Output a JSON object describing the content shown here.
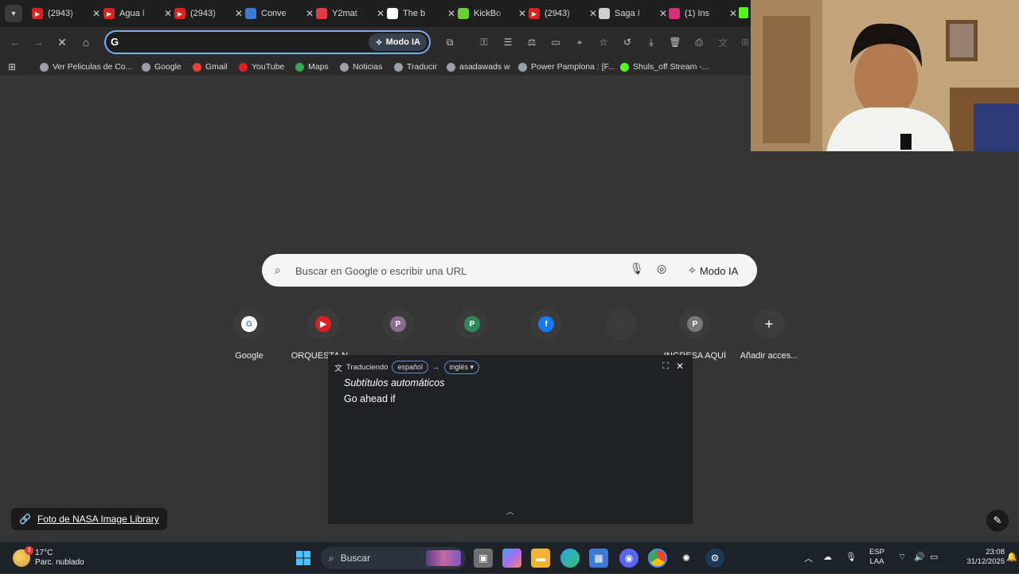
{
  "tabs": [
    {
      "title": "(2943)",
      "icon": "youtube-icon",
      "color": "#e02020"
    },
    {
      "title": "Agua I",
      "icon": "youtube-icon",
      "color": "#e02020"
    },
    {
      "title": "(2943)",
      "icon": "youtube-icon",
      "color": "#e02020"
    },
    {
      "title": "Conve",
      "icon": "convert-icon",
      "color": "#3a7bd5"
    },
    {
      "title": "Y2mat",
      "icon": "download-icon",
      "color": "#e0394a"
    },
    {
      "title": "The b",
      "icon": "diamond-icon",
      "color": "#ffffff"
    },
    {
      "title": "KickBo",
      "icon": "kickbox-icon",
      "color": "#6ad12a"
    },
    {
      "title": "(2943)",
      "icon": "youtube-icon",
      "color": "#e02020"
    },
    {
      "title": "Saga I",
      "icon": "openai-icon",
      "color": "#cfcfcf"
    },
    {
      "title": "(1) Ins",
      "icon": "instagram-icon",
      "color": "#d6307a"
    }
  ],
  "omnibox": {
    "value": "",
    "ai_label": "Modo IA"
  },
  "bookmarks": [
    {
      "label": "Ver Peliculas de Co...",
      "icon": "globe-icon",
      "color": "#9aa0a6"
    },
    {
      "label": "Google",
      "icon": "globe-icon",
      "color": "#9aa0a6"
    },
    {
      "label": "Gmail",
      "icon": "gmail-icon",
      "color": "#ea4335"
    },
    {
      "label": "YouTube",
      "icon": "youtube-icon",
      "color": "#e02020"
    },
    {
      "label": "Maps",
      "icon": "maps-icon",
      "color": "#34a853"
    },
    {
      "label": "Noticias",
      "icon": "globe-icon",
      "color": "#9aa0a6"
    },
    {
      "label": "Traducir",
      "icon": "globe-icon",
      "color": "#9aa0a6"
    },
    {
      "label": "asadawads w",
      "icon": "globe-icon",
      "color": "#9aa0a6"
    },
    {
      "label": "Power Pamplona : [F...",
      "icon": "globe-icon",
      "color": "#9aa0a6"
    },
    {
      "label": "Shuls_off Stream -...",
      "icon": "kick-icon",
      "color": "#53fc18"
    }
  ],
  "ntp": {
    "search_placeholder": "Buscar en Google o escribir una URL",
    "ai_label": "Modo IA",
    "shortcuts": [
      {
        "label": "Google",
        "glyph": "G",
        "color": "#4285f4"
      },
      {
        "label": "ORQUESTA N...",
        "glyph": "▶",
        "color": "#e02020"
      },
      {
        "label": "",
        "glyph": "P",
        "color": "#8a6d8e"
      },
      {
        "label": "",
        "glyph": "P",
        "color": "#2e8b57"
      },
      {
        "label": "",
        "glyph": "f",
        "color": "#1877f2"
      },
      {
        "label": "",
        "glyph": "",
        "color": "#3b3b3b"
      },
      {
        "label": "INGRESA AQUÍ",
        "glyph": "P",
        "color": "#777777"
      },
      {
        "label": "Añadir acces...",
        "glyph": "+",
        "color": "#3b3b3b"
      }
    ]
  },
  "caption": {
    "mode": "Traduciendo",
    "from": "español",
    "to": "inglés",
    "title": "Subtítulos automáticos",
    "text": "Go ahead if"
  },
  "attribution": "Foto de NASA Image Library",
  "taskbar": {
    "weather_temp": "17°C",
    "weather_desc": "Parc. nublado",
    "weather_badge": "3",
    "search_label": "Buscar",
    "lang_1": "ESP",
    "lang_2": "LAA",
    "time": "23:08",
    "date": "31/12/2025"
  }
}
